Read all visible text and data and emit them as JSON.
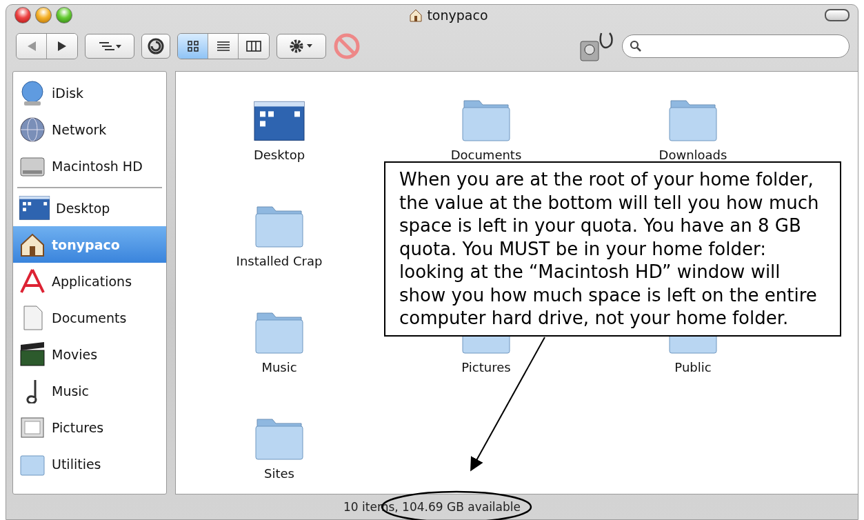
{
  "window": {
    "title": "tonypaco"
  },
  "toolbar": {
    "view_modes": [
      {
        "selected": true
      },
      {
        "selected": false
      },
      {
        "selected": false
      }
    ]
  },
  "sidebar": {
    "devices": [
      {
        "label": "iDisk"
      },
      {
        "label": "Network"
      },
      {
        "label": "Macintosh HD"
      }
    ],
    "places": [
      {
        "label": "Desktop",
        "selected": false
      },
      {
        "label": "tonypaco",
        "selected": true
      },
      {
        "label": "Applications",
        "selected": false
      },
      {
        "label": "Documents",
        "selected": false
      },
      {
        "label": "Movies",
        "selected": false
      },
      {
        "label": "Music",
        "selected": false
      },
      {
        "label": "Pictures",
        "selected": false
      },
      {
        "label": "Utilities",
        "selected": false
      }
    ]
  },
  "file_rows": [
    [
      {
        "name": "Desktop"
      },
      {
        "name": "Documents"
      },
      {
        "name": "Downloads"
      }
    ],
    [
      {
        "name": "Installed Crap"
      }
    ],
    [
      {
        "name": "Music"
      },
      {
        "name": "Pictures"
      },
      {
        "name": "Public"
      }
    ],
    [
      {
        "name": "Sites"
      }
    ]
  ],
  "status_bar": "10 items, 104.69 GB available",
  "annotation": {
    "text": "When you are at the root of your home folder, the value at the bottom will tell you how much space is left in your quota. You have an 8 GB quota. You MUST be in your home folder: looking at the “Macintosh HD” window will show you how much space is left on the entire computer hard drive, not your home folder."
  }
}
